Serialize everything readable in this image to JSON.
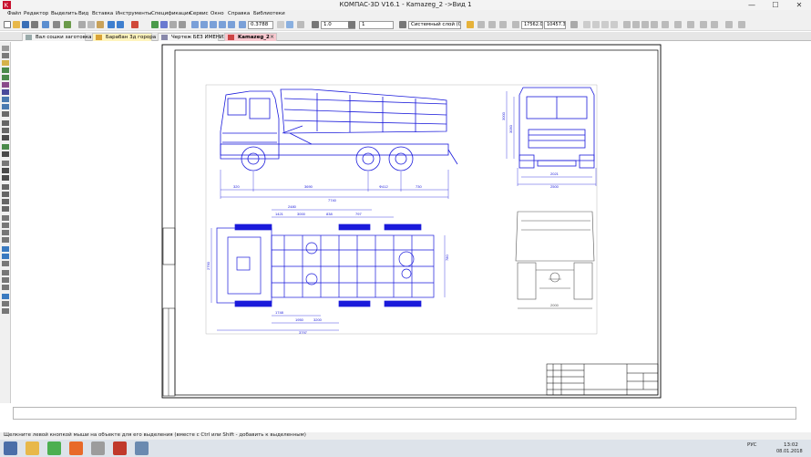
{
  "window": {
    "title": "КОМПАС-3D V16.1 - Kamazeg_2 ->Вид 1",
    "min": "—",
    "max": "☐",
    "close": "✕"
  },
  "menu": [
    "Файл",
    "Редактор",
    "Выделить",
    "Вид",
    "Вставка",
    "Инструменты",
    "Спецификация",
    "Сервис",
    "Окно",
    "Справка",
    "Библиотеки"
  ],
  "toolbar": {
    "zoom": "0.3788",
    "line_scale": "1.0",
    "style_num": "1",
    "layer": "Системный слой (0)",
    "coord_x": "17562.0",
    "coord_y": "10457.3"
  },
  "tabs": [
    {
      "label": "Вал сошки заготовка",
      "active": false
    },
    {
      "label": "Барабан 3д горора",
      "active": false
    },
    {
      "label": "Чертеж БЕЗ ИМЕНИ1",
      "active": false
    },
    {
      "label": "Kamazeg_2",
      "active": true
    }
  ],
  "dimensions": {
    "side": [
      "320",
      "3690",
      "1320",
      "Ф412",
      "730",
      "7740",
      "3000",
      "3050"
    ],
    "front": [
      "2021",
      "2500"
    ],
    "top": [
      "2480",
      "1421",
      "3000",
      "838",
      "797",
      "780",
      "2960",
      "1748",
      "2790",
      "1950",
      "3200",
      "3797"
    ],
    "rear": [
      "2000"
    ]
  },
  "status": {
    "message": "Щелкните левой кнопкой мыши на объекте для его выделения (вместе с Ctrl или Shift - добавить к выделенным)"
  },
  "taskbar": {
    "lang": "РУС",
    "time": "13:02",
    "date": "08.01.2018"
  },
  "colors": {
    "drawing": "#1a1adb",
    "grey_drawing": "#555555",
    "active_tab": "#f7c8cf",
    "tab_bg": "#fff4bd"
  }
}
